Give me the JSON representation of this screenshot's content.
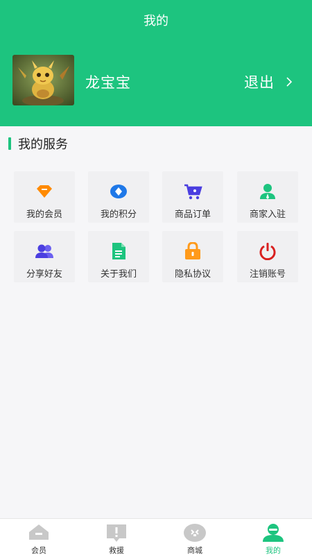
{
  "header": {
    "title": "我的",
    "username": "龙宝宝",
    "logout_label": "退出",
    "bg_color": "#1dc47f"
  },
  "services": {
    "title": "我的服务",
    "items": [
      {
        "label": "我的会员",
        "icon": "diamond-icon",
        "color": "#ff8a00"
      },
      {
        "label": "我的积分",
        "icon": "points-icon",
        "color": "#1f78e8"
      },
      {
        "label": "商品订单",
        "icon": "cart-icon",
        "color": "#4b3fe0"
      },
      {
        "label": "商家入驻",
        "icon": "merchant-icon",
        "color": "#1dc47f"
      },
      {
        "label": "分享好友",
        "icon": "users-icon",
        "color": "#4b3fe0"
      },
      {
        "label": "关于我们",
        "icon": "document-icon",
        "color": "#1dc47f"
      },
      {
        "label": "隐私协议",
        "icon": "lock-icon",
        "color": "#ff9a1a"
      },
      {
        "label": "注销账号",
        "icon": "power-icon",
        "color": "#d92020"
      }
    ]
  },
  "tabbar": {
    "items": [
      {
        "label": "会员",
        "icon": "home-icon"
      },
      {
        "label": "救援",
        "icon": "alert-icon"
      },
      {
        "label": "商城",
        "icon": "mall-icon"
      },
      {
        "label": "我的",
        "icon": "user-icon",
        "active": true
      }
    ]
  }
}
